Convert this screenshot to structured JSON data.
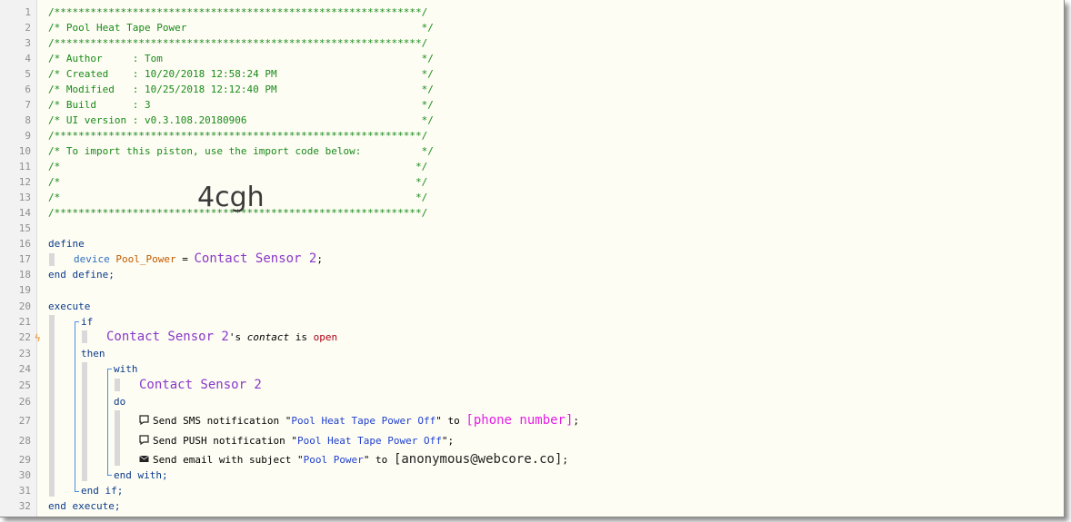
{
  "lines": [
    {
      "n": "1",
      "t": "/*************************************************************/"
    },
    {
      "n": "2",
      "t": "/* Pool Heat Tape Power                                       */"
    },
    {
      "n": "3",
      "t": "/*************************************************************/"
    },
    {
      "n": "4",
      "t": "/* Author     : Tom                                           */"
    },
    {
      "n": "5",
      "t": "/* Created    : 10/20/2018 12:58:24 PM                        */"
    },
    {
      "n": "6",
      "t": "/* Modified   : 10/25/2018 12:12:40 PM                        */"
    },
    {
      "n": "7",
      "t": "/* Build      : 3                                             */"
    },
    {
      "n": "8",
      "t": "/* UI version : v0.3.108.20180906                             */"
    },
    {
      "n": "9",
      "t": "/*************************************************************/"
    },
    {
      "n": "10",
      "t": "/* To import this piston, use the import code below:          */"
    },
    {
      "n": "11",
      "t": "/*                                                           */"
    },
    {
      "n": "12",
      "t": "/*                                                           */"
    },
    {
      "n": "13",
      "t": "/*                                                           */"
    },
    {
      "n": "14",
      "t": "/*************************************************************/"
    },
    {
      "n": "15",
      "t": ""
    },
    {
      "n": "16",
      "t": "define"
    },
    {
      "n": "17",
      "t": ""
    },
    {
      "n": "18",
      "t": "end define;"
    },
    {
      "n": "19",
      "t": ""
    },
    {
      "n": "20",
      "t": "execute"
    },
    {
      "n": "21",
      "t": "if"
    },
    {
      "n": "22",
      "t": ""
    },
    {
      "n": "23",
      "t": "then"
    },
    {
      "n": "24",
      "t": "with"
    },
    {
      "n": "25",
      "t": ""
    },
    {
      "n": "26",
      "t": "do"
    },
    {
      "n": "27",
      "t": ""
    },
    {
      "n": "28",
      "t": ""
    },
    {
      "n": "29",
      "t": ""
    },
    {
      "n": "30",
      "t": "end with;"
    },
    {
      "n": "31",
      "t": "end if;"
    },
    {
      "n": "32",
      "t": "end execute;"
    }
  ],
  "import_code": "4cgh",
  "define": {
    "keyword": "device",
    "var": "Pool_Power",
    "eq": " = ",
    "device": "Contact Sensor 2",
    "semi": ";"
  },
  "condition": {
    "device": "Contact Sensor 2",
    "poss": "'s ",
    "attr": "contact",
    "is": " is ",
    "value": "open"
  },
  "with_device": "Contact Sensor 2",
  "actions": [
    {
      "icon": "comment-icon",
      "pre": "Send SMS notification \"",
      "msg": "Pool Heat Tape Power Off",
      "post": "\" to ",
      "target": "[phone number]",
      "end": ";"
    },
    {
      "icon": "comment-icon",
      "pre": "Send PUSH notification \"",
      "msg": "Pool Heat Tape Power Off",
      "post": "\";",
      "target": "",
      "end": ""
    },
    {
      "icon": "envelope-icon",
      "pre": "Send email with subject \"",
      "msg": "Pool Power",
      "post": "\" to ",
      "target": "[anonymous@webcore.co]",
      "end": ";"
    }
  ]
}
